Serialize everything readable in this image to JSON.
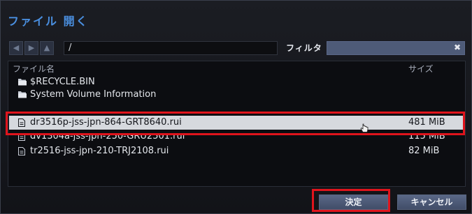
{
  "dialog": {
    "title": "ファイル 開く"
  },
  "toolbar": {
    "path": "/",
    "filter_label": "フィルタ",
    "filter_clear": "✖",
    "back_icon": "◀",
    "forward_icon": "▶",
    "up_icon": "▲"
  },
  "list": {
    "columns": {
      "name": "ファイル名",
      "size": "サイズ"
    },
    "folders": [
      {
        "name": "$RECYCLE.BIN"
      },
      {
        "name": "System Volume Information"
      }
    ],
    "files": [
      {
        "name": "dr3516p-jss-jpn-864-GRT8640.rui",
        "size": "481 MiB",
        "selected": true
      },
      {
        "name": "dv1304a-jss-jpn-250-GRU2501.rui",
        "size": "115 MiB"
      },
      {
        "name": "tr2516-jss-jpn-210-TRJ2108.rui",
        "size": "82 MiB"
      }
    ]
  },
  "buttons": {
    "ok": "決定",
    "cancel": "キャンセル"
  },
  "colors": {
    "accent": "#4a8fe0",
    "highlight": "#e0141c",
    "selection": "#d6d9de"
  }
}
